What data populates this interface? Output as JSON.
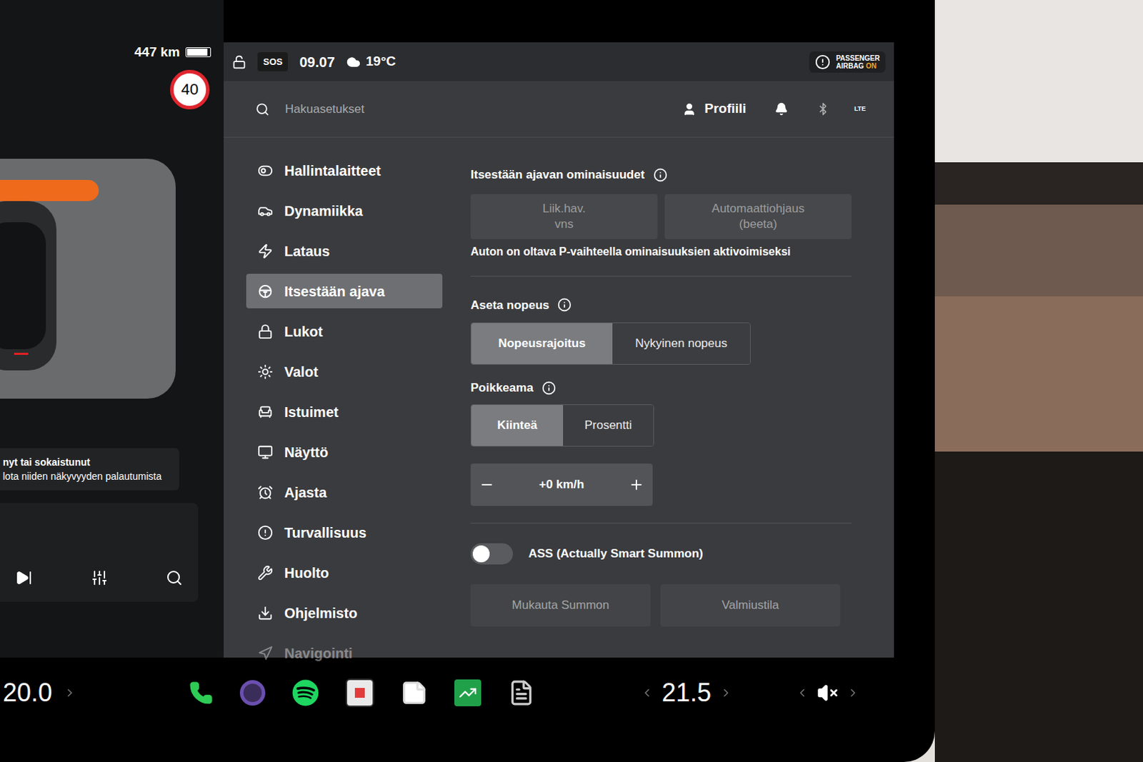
{
  "left_panel": {
    "range": "447 km",
    "battery_level": 0.9,
    "speed_limit": "40",
    "notification": [
      "nyt tai sokaistunut",
      "lota niiden näkyvyyden palautumista"
    ]
  },
  "status_bar": {
    "sos": "SOS",
    "time": "09.07",
    "temperature": "19°C",
    "signal": "LTE",
    "airbag_badge": {
      "line1": "PASSENGER",
      "line2": "AIRBAG",
      "state": "ON"
    }
  },
  "search": {
    "placeholder": "Hakuasetukset"
  },
  "profile": "Profiili",
  "sidebar": {
    "items": [
      {
        "label": "Hallintalaitteet",
        "selected": false,
        "faded": false
      },
      {
        "label": "Dynamiikka",
        "selected": false,
        "faded": false
      },
      {
        "label": "Lataus",
        "selected": false,
        "faded": false
      },
      {
        "label": "Itsestään ajava",
        "selected": true,
        "faded": false
      },
      {
        "label": "Lukot",
        "selected": false,
        "faded": false
      },
      {
        "label": "Valot",
        "selected": false,
        "faded": false
      },
      {
        "label": "Istuimet",
        "selected": false,
        "faded": false
      },
      {
        "label": "Näyttö",
        "selected": false,
        "faded": false
      },
      {
        "label": "Ajasta",
        "selected": false,
        "faded": false
      },
      {
        "label": "Turvallisuus",
        "selected": false,
        "faded": false
      },
      {
        "label": "Huolto",
        "selected": false,
        "faded": false
      },
      {
        "label": "Ohjelmisto",
        "selected": false,
        "faded": false
      },
      {
        "label": "Navigointi",
        "selected": false,
        "faded": true
      }
    ]
  },
  "content": {
    "features": {
      "title": "Itsestään ajavan ominaisuudet",
      "options": [
        {
          "lines": [
            "Liik.hav.",
            "vns"
          ],
          "disabled": true
        },
        {
          "lines": [
            "Automaattiohjaus",
            "(beeta)"
          ],
          "disabled": true
        }
      ],
      "note": "Auton on oltava P-vaihteella ominaisuuksien aktivoimiseksi"
    },
    "set_speed": {
      "title": "Aseta nopeus",
      "options": [
        {
          "label": "Nopeusrajoitus",
          "selected": true
        },
        {
          "label": "Nykyinen nopeus",
          "selected": false
        }
      ]
    },
    "offset": {
      "title": "Poikkeama",
      "options": [
        {
          "label": "Kiinteä",
          "selected": true
        },
        {
          "label": "Prosentti",
          "selected": false
        }
      ],
      "value": "+0 km/h"
    },
    "summon_toggle": {
      "label": "ASS (Actually Smart Summon)",
      "on": false
    },
    "buttons": [
      {
        "label": "Mukauta Summon",
        "disabled": true
      },
      {
        "label": "Valmiustila",
        "disabled": true
      }
    ]
  },
  "bottom_bar": {
    "driver_temp": "20.0",
    "passenger_temp": "21.5",
    "muted": true
  }
}
